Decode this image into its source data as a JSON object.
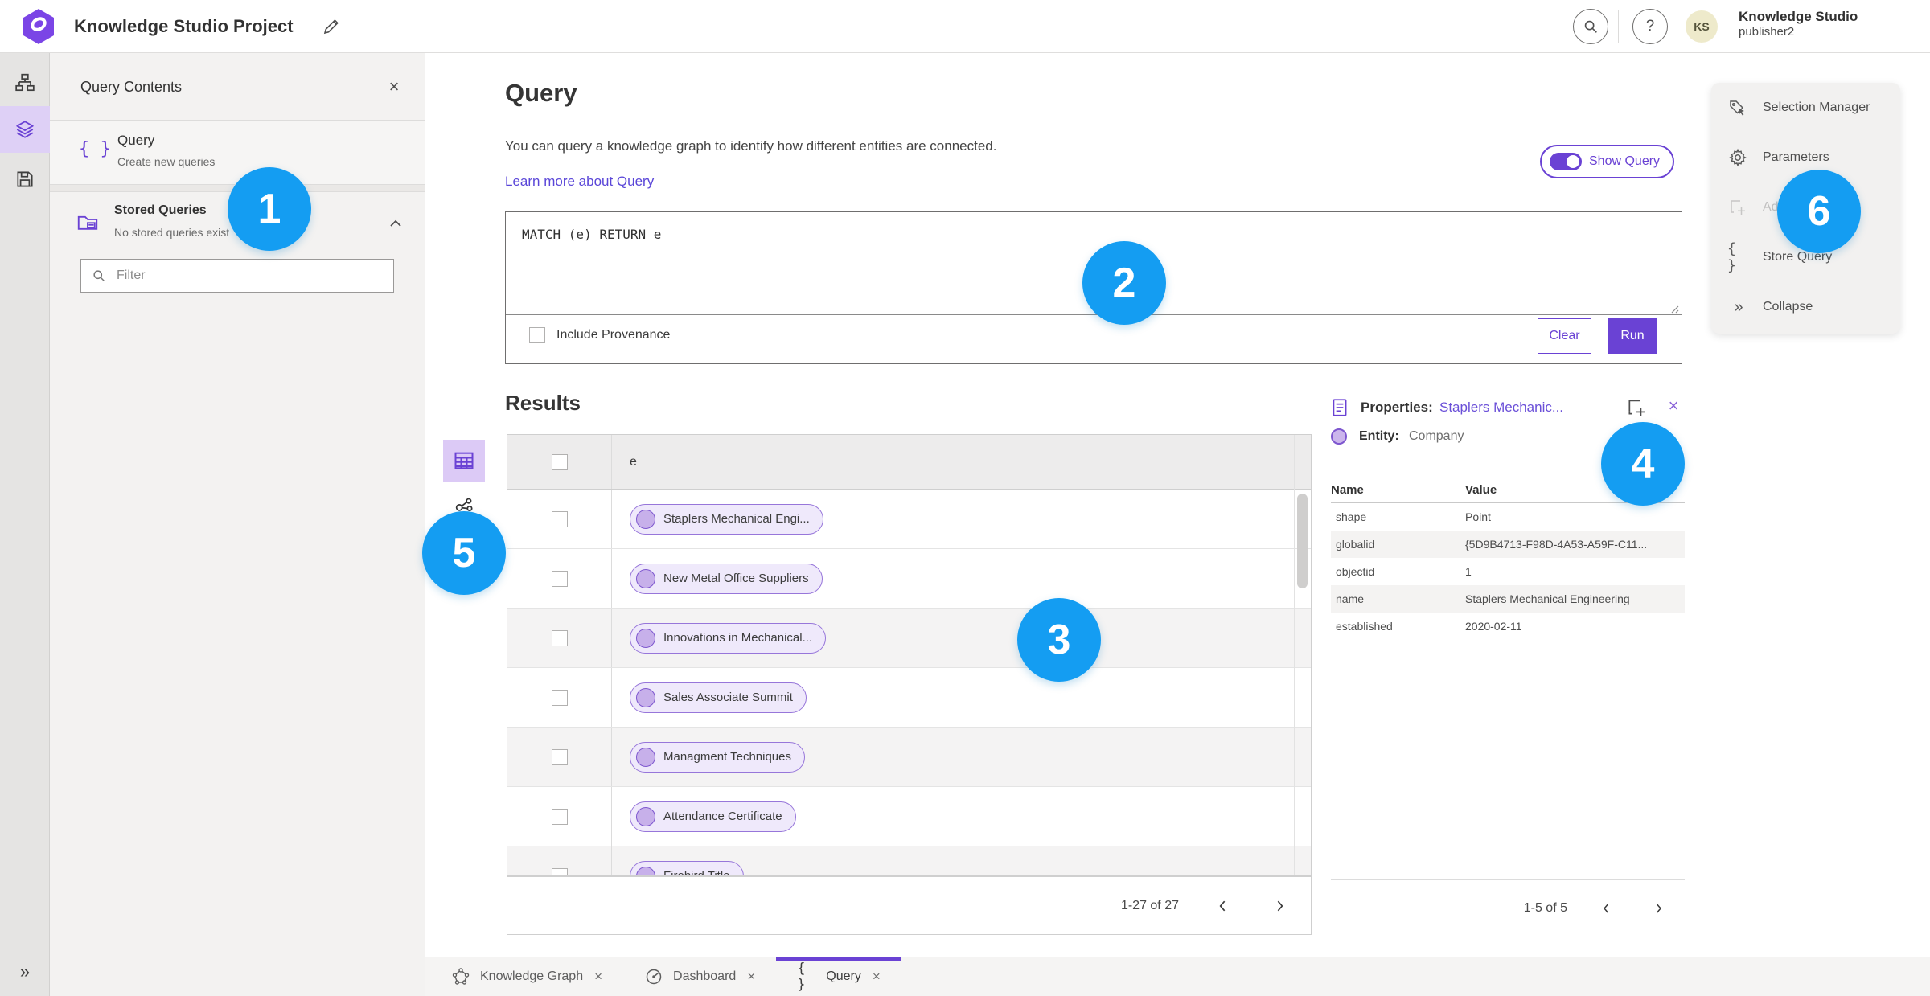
{
  "colors": {
    "accent": "#6a42d4",
    "annotation_blue": "#149df2",
    "avatar_bg": "#eeeacb",
    "chip_bg": "#efe9fb"
  },
  "topbar": {
    "title": "Knowledge Studio Project",
    "user": {
      "initials": "KS",
      "name": "Knowledge Studio",
      "role": "publisher2"
    }
  },
  "sidebar": {
    "title": "Query Contents",
    "query_item": {
      "title": "Query",
      "subtitle": "Create new queries"
    },
    "stored": {
      "title": "Stored Queries",
      "subtitle": "No stored queries exist"
    },
    "filter_placeholder": "Filter"
  },
  "query": {
    "heading": "Query",
    "description": "You can query a knowledge graph to identify how different entities are connected.",
    "learn_more": "Learn more about Query",
    "show_query_label": "Show Query",
    "code": "MATCH (e) RETURN e",
    "include_provenance": "Include Provenance",
    "clear_label": "Clear",
    "run_label": "Run"
  },
  "results": {
    "heading": "Results",
    "column_header": "e",
    "rows": [
      {
        "label": "Staplers Mechanical Engi..."
      },
      {
        "label": "New Metal Office Suppliers"
      },
      {
        "label": "Innovations in Mechanical..."
      },
      {
        "label": "Sales Associate Summit"
      },
      {
        "label": "Managment Techniques"
      },
      {
        "label": "Attendance Certificate"
      },
      {
        "label": "Firebird Title"
      }
    ],
    "pagination": "1-27 of 27"
  },
  "properties": {
    "header_prefix": "Properties:",
    "header_link": "Staplers Mechanic...",
    "entity_label": "Entity:",
    "entity_value": "Company",
    "col_name": "Name",
    "col_value": "Value",
    "rows": [
      {
        "name": "shape",
        "value": "Point"
      },
      {
        "name": "globalid",
        "value": "{5D9B4713-F98D-4A53-A59F-C11..."
      },
      {
        "name": "objectid",
        "value": "1"
      },
      {
        "name": "name",
        "value": "Staplers Mechanical Engineering"
      },
      {
        "name": "established",
        "value": "2020-02-11"
      }
    ],
    "pagination": "1-5 of 5"
  },
  "menu": {
    "items": [
      {
        "label": "Selection Manager"
      },
      {
        "label": "Parameters"
      },
      {
        "label": "Add",
        "disabled": true
      },
      {
        "label": "Store Query"
      },
      {
        "label": "Collapse"
      }
    ]
  },
  "tabs": [
    {
      "label": "Knowledge Graph"
    },
    {
      "label": "Dashboard"
    },
    {
      "label": "Query",
      "active": true
    }
  ],
  "annotations": [
    "1",
    "2",
    "3",
    "4",
    "5",
    "6"
  ]
}
